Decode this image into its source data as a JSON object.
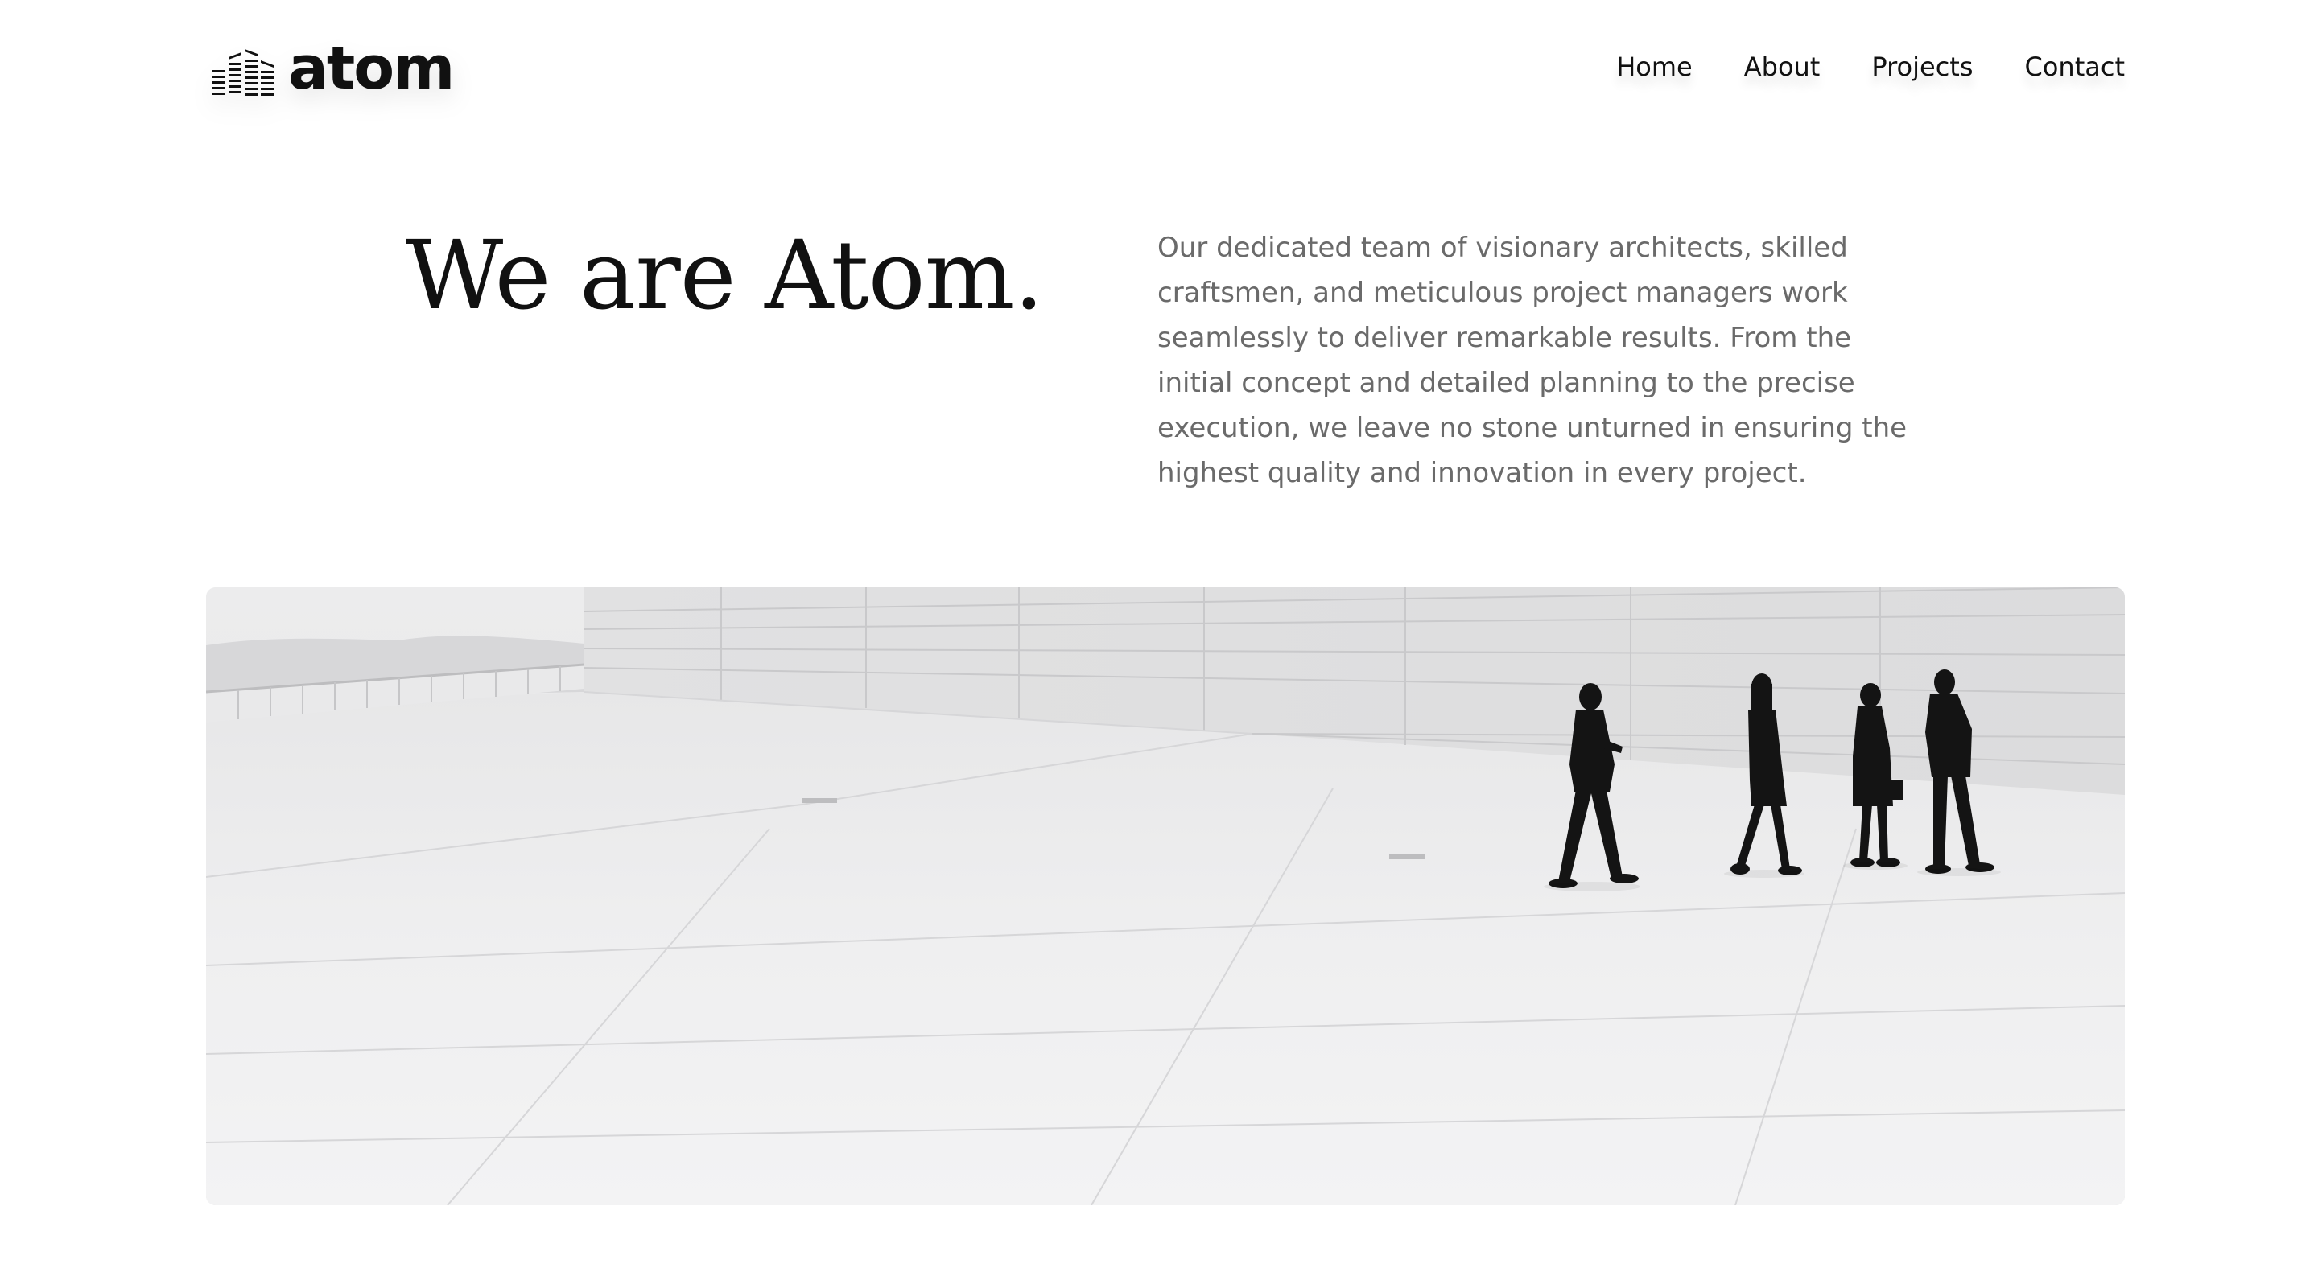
{
  "brand": {
    "name": "atom",
    "logo_icon": "city-buildings-icon"
  },
  "nav": {
    "items": [
      {
        "label": "Home"
      },
      {
        "label": "About"
      },
      {
        "label": "Projects"
      },
      {
        "label": "Contact"
      }
    ]
  },
  "hero": {
    "title": "We are Atom.",
    "description": "Our dedicated team of visionary architects, skilled craftsmen, and meticulous project managers work seamlessly to deliver remarkable results. From the initial concept and detailed planning to the precise execution, we leave no stone unturned in ensuring the highest quality and innovation in every project."
  },
  "image": {
    "subject": "people-walking-on-white-plaza",
    "style": "black-and-white"
  },
  "colors": {
    "text": "#111111",
    "muted_text": "#6a6a6a",
    "background": "#ffffff"
  }
}
